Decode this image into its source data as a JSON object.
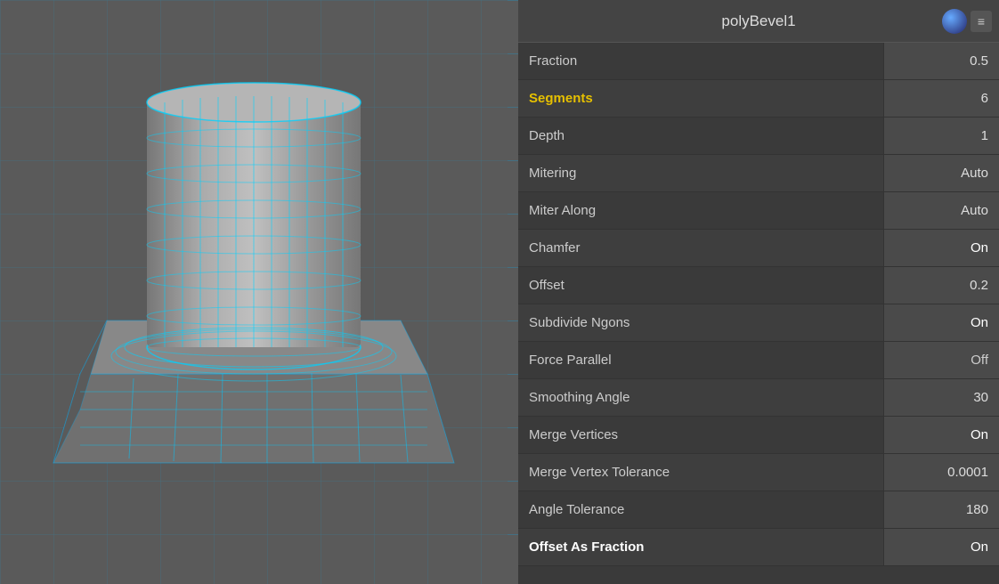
{
  "header": {
    "title": "polyBevel1"
  },
  "properties": [
    {
      "label": "Fraction",
      "value": "0.5",
      "labelStyle": "normal",
      "valueStyle": "normal"
    },
    {
      "label": "Segments",
      "value": "6",
      "labelStyle": "highlighted",
      "valueStyle": "normal"
    },
    {
      "label": "Depth",
      "value": "1",
      "labelStyle": "normal",
      "valueStyle": "normal"
    },
    {
      "label": "Mitering",
      "value": "Auto",
      "labelStyle": "normal",
      "valueStyle": "normal"
    },
    {
      "label": "Miter Along",
      "value": "Auto",
      "labelStyle": "normal",
      "valueStyle": "normal"
    },
    {
      "label": "Chamfer",
      "value": "On",
      "labelStyle": "normal",
      "valueStyle": "on"
    },
    {
      "label": "Offset",
      "value": "0.2",
      "labelStyle": "normal",
      "valueStyle": "normal"
    },
    {
      "label": "Subdivide Ngons",
      "value": "On",
      "labelStyle": "normal",
      "valueStyle": "on"
    },
    {
      "label": "Force Parallel",
      "value": "Off",
      "labelStyle": "normal",
      "valueStyle": "off"
    },
    {
      "label": "Smoothing Angle",
      "value": "30",
      "labelStyle": "normal",
      "valueStyle": "normal"
    },
    {
      "label": "Merge Vertices",
      "value": "On",
      "labelStyle": "normal",
      "valueStyle": "on"
    },
    {
      "label": "Merge Vertex Tolerance",
      "value": "0.0001",
      "labelStyle": "normal",
      "valueStyle": "normal"
    },
    {
      "label": "Angle Tolerance",
      "value": "180",
      "labelStyle": "normal",
      "valueStyle": "normal"
    },
    {
      "label": "Offset As Fraction",
      "value": "On",
      "labelStyle": "bold-white",
      "valueStyle": "on"
    }
  ],
  "icons": {
    "menu_dots": "≡"
  }
}
